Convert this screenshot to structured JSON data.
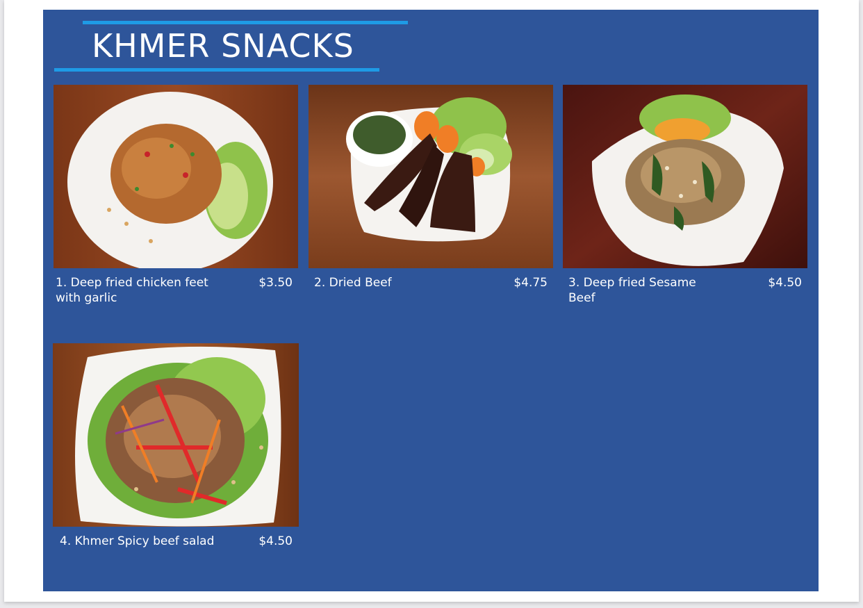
{
  "menu": {
    "title": "KHMER SNACKS",
    "items": [
      {
        "name": "1. Deep fried chicken feet with garlic",
        "price": "$3.50",
        "image": "fried-chicken-feet-photo"
      },
      {
        "name": "2. Dried Beef",
        "price": "$4.75",
        "image": "dried-beef-photo"
      },
      {
        "name": "3. Deep fried Sesame Beef",
        "price": "$4.50",
        "image": "sesame-beef-photo"
      },
      {
        "name": "4. Khmer Spicy beef salad",
        "price": "$4.50",
        "image": "spicy-beef-salad-photo"
      }
    ]
  },
  "colors": {
    "panel": "#2e559a",
    "accent_rule": "#1e9be6",
    "text": "#ffffff"
  }
}
